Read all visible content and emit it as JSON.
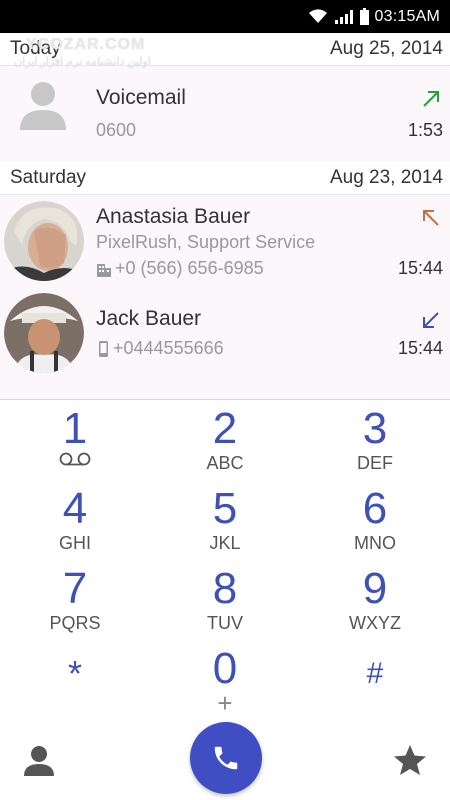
{
  "status_bar": {
    "time": "03:15AM"
  },
  "watermark": {
    "line1": "YCOZAR.COM",
    "line2": "اولین دانشنامه نرم افزار ایران"
  },
  "call_log": {
    "sections": [
      {
        "label": "Today",
        "date": "Aug 25, 2014",
        "calls": [
          {
            "name": "Voicemail",
            "number": "0600",
            "time": "1:53",
            "direction": "outgoing",
            "arrow_color": "#2e9e3a"
          }
        ]
      },
      {
        "label": "Saturday",
        "date": "Aug 23, 2014",
        "calls": [
          {
            "name": "Anastasia Bauer",
            "company": "PixelRush, Support Service",
            "number": "+0 (566) 656-6985",
            "number_type_icon": "building-icon",
            "time": "15:44",
            "direction": "missed",
            "arrow_color": "#c0704a"
          },
          {
            "name": "Jack Bauer",
            "number": "+0444555666",
            "number_type_icon": "mobile-icon",
            "time": "15:44",
            "direction": "incoming",
            "arrow_color": "#3f51b5"
          }
        ]
      }
    ]
  },
  "dialpad": {
    "accent": "#3f51b5",
    "keys": [
      {
        "digit": "1",
        "letters": "",
        "sub_icon": "voicemail-icon"
      },
      {
        "digit": "2",
        "letters": "ABC"
      },
      {
        "digit": "3",
        "letters": "DEF"
      },
      {
        "digit": "4",
        "letters": "GHI"
      },
      {
        "digit": "5",
        "letters": "JKL"
      },
      {
        "digit": "6",
        "letters": "MNO"
      },
      {
        "digit": "7",
        "letters": "PQRS"
      },
      {
        "digit": "8",
        "letters": "TUV"
      },
      {
        "digit": "9",
        "letters": "WXYZ"
      },
      {
        "digit": "*",
        "letters": ""
      },
      {
        "digit": "0",
        "letters": "+"
      },
      {
        "digit": "#",
        "letters": ""
      }
    ]
  },
  "bottom_bar": {
    "left_icon": "person-icon",
    "center_icon": "phone-icon",
    "right_icon": "star-icon",
    "call_button_color": "#3f4ec2"
  }
}
